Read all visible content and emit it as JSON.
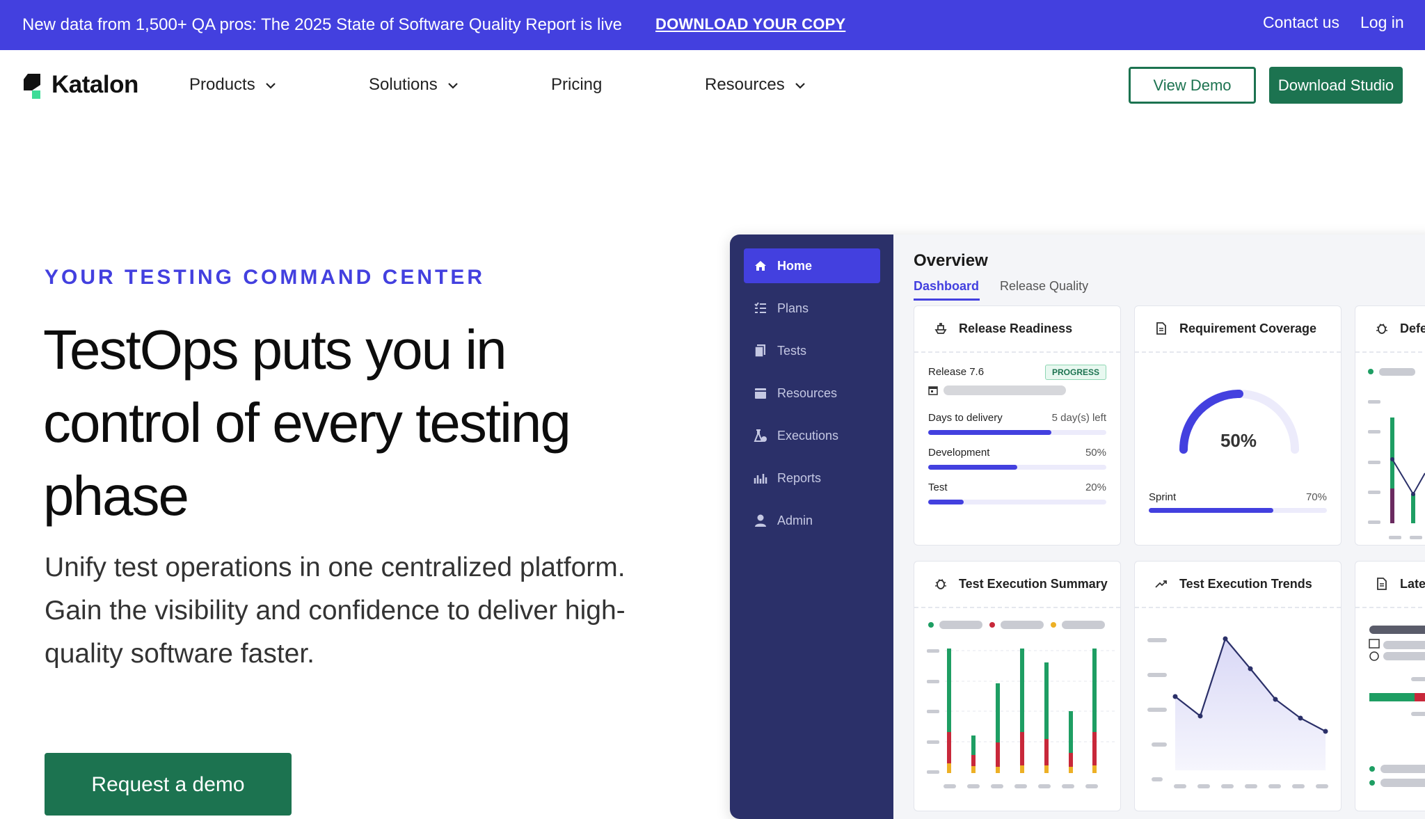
{
  "banner": {
    "text": "New data from 1,500+ QA pros: The 2025 State of Software Quality Report is live",
    "cta": "DOWNLOAD YOUR COPY",
    "contact": "Contact us",
    "login": "Log in"
  },
  "nav": {
    "logo": "Katalon",
    "items": [
      "Products",
      "Solutions",
      "Pricing",
      "Resources"
    ],
    "view_demo": "View Demo",
    "download": "Download Studio"
  },
  "hero": {
    "eyebrow": "YOUR TESTING COMMAND CENTER",
    "title_line1": "TestOps puts you in",
    "title_line2": "control of every testing",
    "title_line3": "phase",
    "subtitle_line1": "Unify test operations in one centralized platform.",
    "subtitle_line2": "Gain the visibility and confidence to deliver high-",
    "subtitle_line3": "quality software faster.",
    "cta": "Request a demo"
  },
  "dashboard": {
    "sidebar": [
      "Home",
      "Plans",
      "Tests",
      "Resources",
      "Executions",
      "Reports",
      "Admin"
    ],
    "title": "Overview",
    "tabs": [
      "Dashboard",
      "Release Quality"
    ],
    "cards": {
      "release_readiness": {
        "title": "Release Readiness",
        "release": "Release 7.6",
        "badge": "PROGRESS",
        "rows": [
          {
            "label": "Days to delivery",
            "value": "5 day(s) left",
            "progress": 0.69
          },
          {
            "label": "Development",
            "value": "50%",
            "progress": 0.5
          },
          {
            "label": "Test",
            "value": "20%",
            "progress": 0.2
          }
        ]
      },
      "requirement_coverage": {
        "title": "Requirement Coverage",
        "gauge_value": "50%",
        "sprint_label": "Sprint",
        "sprint_value": "70%",
        "sprint_progress": 0.7
      },
      "defects": {
        "title": "Defe"
      },
      "execution_summary": {
        "title": "Test Execution Summary"
      },
      "execution_trends": {
        "title": "Test Execution Trends"
      },
      "latest": {
        "title": "Late"
      }
    },
    "colors": {
      "accent": "#4340DF",
      "green": "#1E9E63",
      "red": "#C8283A",
      "yellow": "#EDB025",
      "navy": "#2B3069"
    }
  }
}
